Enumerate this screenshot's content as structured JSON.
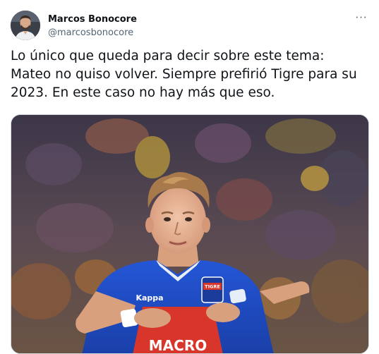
{
  "tweet": {
    "author_name": "Marcos Bonocore",
    "author_handle": "@marcosbonocore",
    "more_label": "···",
    "text": "Lo único que queda para decir sobre este tema:\nMateo no quiso volver. Siempre prefirió Tigre para su 2023. En este caso no hay más que eso."
  },
  "media": {
    "jersey_brand": "Kappa",
    "badge_text": "TIGRE",
    "sponsor_text": "MACRO"
  },
  "colors": {
    "jersey_blue": "#1f4fc9",
    "jersey_red": "#d8362b",
    "text_primary": "#0f1419",
    "text_secondary": "#536471"
  }
}
